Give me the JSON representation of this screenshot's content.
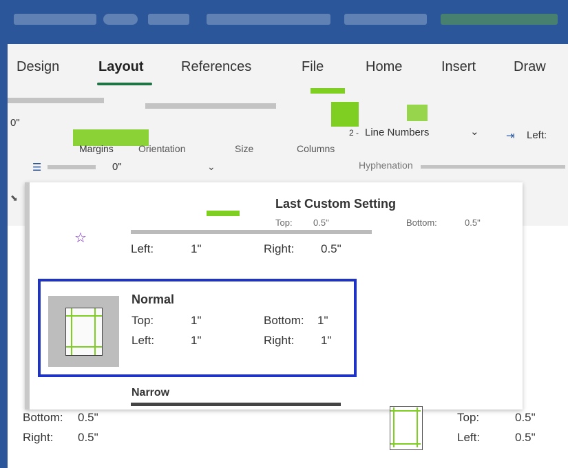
{
  "ribbon_tabs": [
    {
      "label": "Design"
    },
    {
      "label": "Layout",
      "active": true
    },
    {
      "label": "References"
    },
    {
      "label": "File"
    },
    {
      "label": "Home"
    },
    {
      "label": "Insert"
    },
    {
      "label": "Draw"
    }
  ],
  "ribbon": {
    "indent_left_value": "0\"",
    "spacing_value": "0\"",
    "line_numbers": "Line Numbers",
    "line_numbers_chevron": "⌄",
    "left_label": "Left:",
    "margins": "Margins",
    "orientation": "Orientation",
    "size": "Size",
    "columns": "Columns",
    "hyphenation": "Hyphenation"
  },
  "margins_menu": {
    "last_custom": {
      "title": "Last Custom Setting",
      "top_label": "Top:",
      "top_value": "0.5\"",
      "bottom_label": "Bottom:",
      "bottom_value": "0.5\"",
      "left_label": "Left:",
      "left_value": "1\"",
      "right_label": "Right:",
      "right_value": "0.5\""
    },
    "normal": {
      "title": "Normal",
      "top_label": "Top:",
      "top_value": "1\"",
      "bottom_label": "Bottom:",
      "bottom_value": "1\"",
      "left_label": "Left:",
      "left_value": "1\"",
      "right_label": "Right:",
      "right_value": "1\""
    },
    "narrow": {
      "title": "Narrow",
      "bottom_label": "Bottom:",
      "bottom_value": "0.5\"",
      "right_label": "Right:",
      "right_value": "0.5\"",
      "top_label": "Top:",
      "top_value": "0.5\"",
      "left_label": "Left:",
      "left_value": "0.5\""
    }
  },
  "colors": {
    "title_bar": "#2b579a",
    "accent_green": "#7fce22",
    "selection_border": "#1e33c4"
  }
}
